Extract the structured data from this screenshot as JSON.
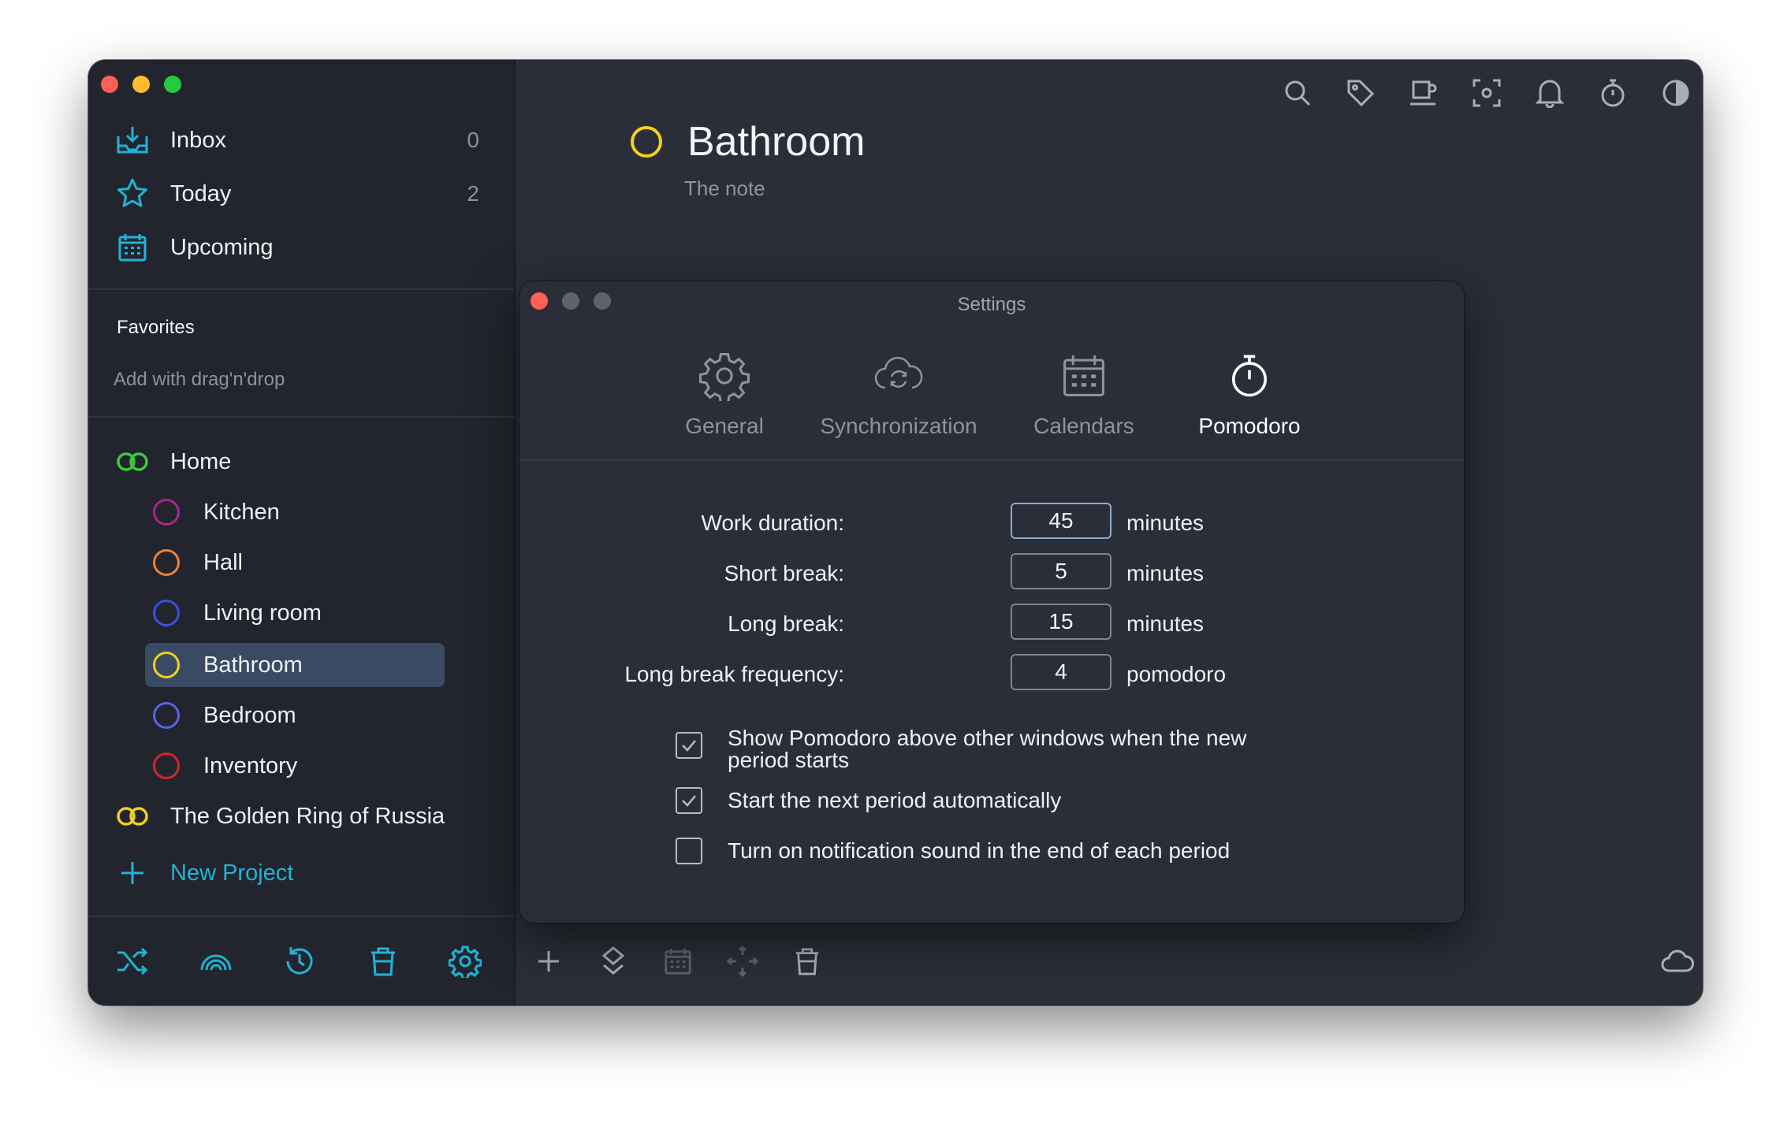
{
  "colors": {
    "accent": "#1fb4d6",
    "selected_row": "#3b4a63",
    "window_bg": "#2b2e38",
    "sidebar_bg": "#22252d"
  },
  "sidebar": {
    "nav": [
      {
        "label": "Inbox",
        "count": "0",
        "icon": "inbox-icon"
      },
      {
        "label": "Today",
        "count": "2",
        "icon": "star-icon"
      },
      {
        "label": "Upcoming",
        "count": "",
        "icon": "calendar-icon"
      }
    ],
    "favorites_title": "Favorites",
    "favorites_hint": "Add with drag'n'drop",
    "projects": [
      {
        "label": "Home",
        "color": "#3ec93e",
        "icon": "area-rings-icon"
      },
      {
        "label": "Kitchen",
        "color": "#b0238f"
      },
      {
        "label": "Hall",
        "color": "#f0803a"
      },
      {
        "label": "Living room",
        "color": "#3b4ee8"
      },
      {
        "label": "Bathroom",
        "color": "#f2d11a",
        "selected": true
      },
      {
        "label": "Bedroom",
        "color": "#5863ea"
      },
      {
        "label": "Inventory",
        "color": "#d4262a"
      },
      {
        "label": "The Golden Ring of Russia",
        "color": "#f2d11a",
        "icon": "area-rings-icon"
      }
    ],
    "new_project": "New Project"
  },
  "task": {
    "title": "Bathroom",
    "note": "The note"
  },
  "settings": {
    "title": "Settings",
    "tabs": [
      {
        "label": "General",
        "icon": "gear-icon"
      },
      {
        "label": "Synchronization",
        "icon": "cloud-sync-icon"
      },
      {
        "label": "Calendars",
        "icon": "calendar-icon"
      },
      {
        "label": "Pomodoro",
        "icon": "stopwatch-icon",
        "active": true
      }
    ],
    "fields": [
      {
        "label": "Work duration:",
        "value": "45",
        "unit": "minutes"
      },
      {
        "label": "Short break:",
        "value": "5",
        "unit": "minutes"
      },
      {
        "label": "Long break:",
        "value": "15",
        "unit": "minutes"
      },
      {
        "label": "Long break frequency:",
        "value": "4",
        "unit": "pomodoro"
      }
    ],
    "checkboxes": [
      {
        "label": "Show Pomodoro above other windows when the new period starts",
        "checked": true
      },
      {
        "label": "Start the next period automatically",
        "checked": true
      },
      {
        "label": "Turn on notification sound in the end of each period",
        "checked": false
      }
    ]
  }
}
